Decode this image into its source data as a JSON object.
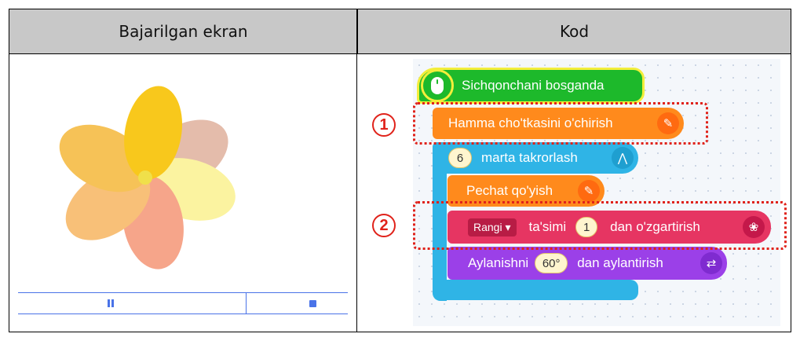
{
  "headers": {
    "left": "Bajarilgan ekran",
    "right": "Kod"
  },
  "controls": {
    "pause_icon": "pause-icon",
    "stop_icon": "stop-icon"
  },
  "blocks": {
    "hat": "Sichqonchani bosganda",
    "clear": "Hamma cho'tkasini o'chirish",
    "repeat_count": "6",
    "repeat_label": "marta takrorlash",
    "stamp": "Pechat qo'yish",
    "color_dropdown": "Rangi ▾",
    "color_mid": "ta'simi",
    "color_value": "1",
    "color_end": "dan o'zgartirish",
    "rotate_label": "Aylanishni",
    "rotate_value": "60°",
    "rotate_end": "dan aylantirish"
  },
  "markers": {
    "one": "①",
    "two": "②"
  },
  "colors": {
    "event": "#1db92b",
    "brush": "#ff8a1c",
    "flow": "#2fb4e6",
    "looks": "#e63562",
    "motion": "#9b40e8",
    "annotation": "#e0221a",
    "player": "#4a73e8"
  }
}
